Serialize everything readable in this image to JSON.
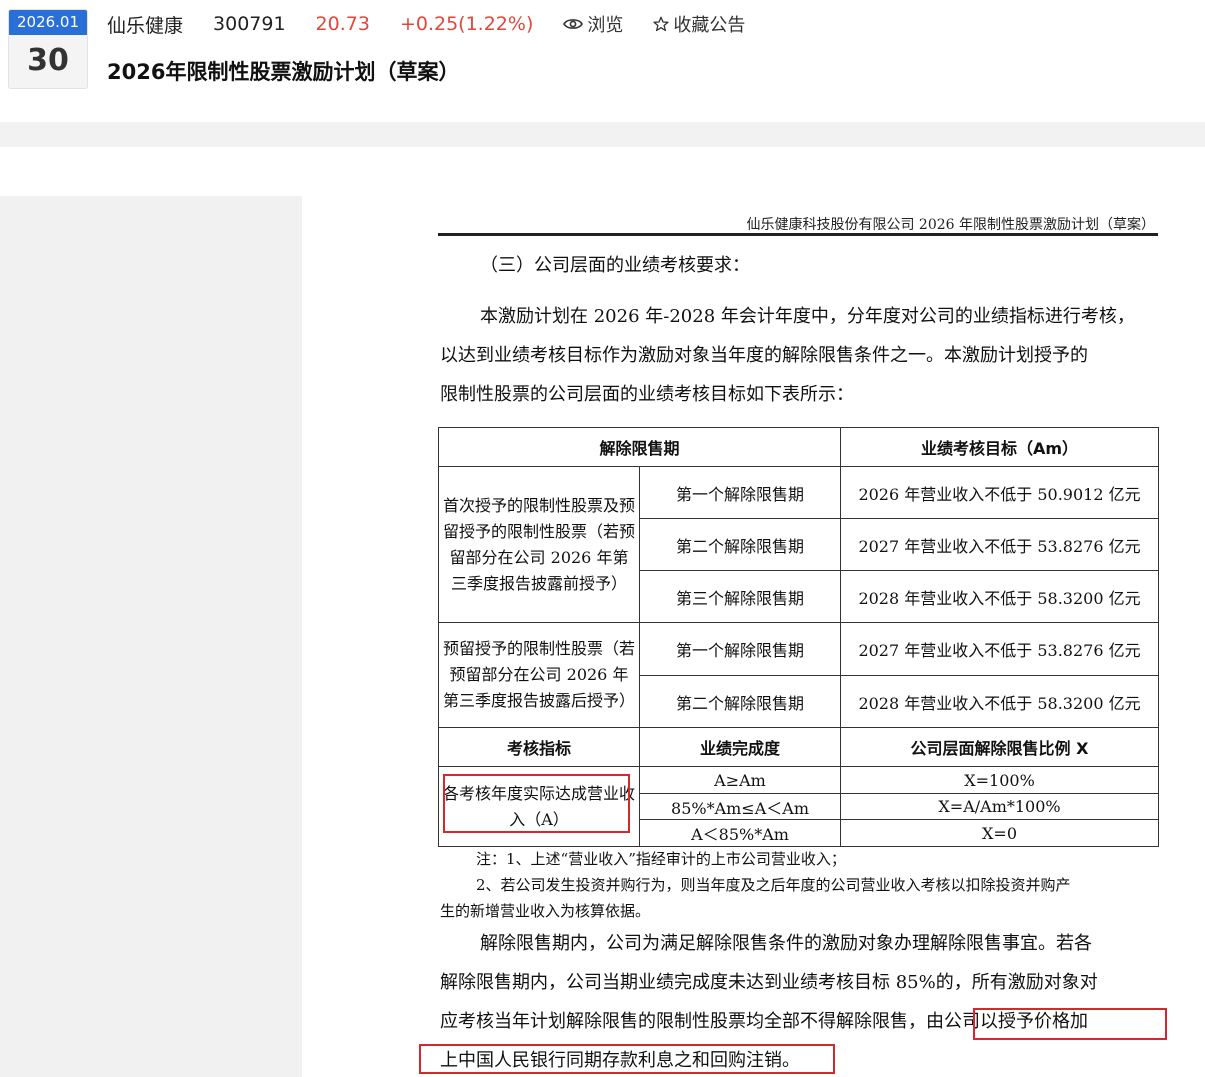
{
  "header": {
    "date_month": "2026.01",
    "date_day": "30",
    "stock_name": "仙乐健康",
    "stock_code": "300791",
    "price": "20.73",
    "change": "+0.25(1.22%)",
    "browse_label": "浏览",
    "favorite_label": "收藏公告",
    "title": "2026年限制性股票激励计划（草案）"
  },
  "colors": {
    "accent_blue": "#2a6fd8",
    "price_red": "#e0483e",
    "highlight_red": "#d6262e"
  },
  "doc": {
    "running_head": "仙乐健康科技股份有限公司 2026 年限制性股票激励计划（草案）",
    "section_heading": "（三）公司层面的业绩考核要求：",
    "intro_lines": [
      "本激励计划在 2026 年-2028 年会计年度中，分年度对公司的业绩指标进行考核，",
      "以达到业绩考核目标作为激励对象当年度的解除限售条件之一。本激励计划授予的",
      "限制性股票的公司层面的业绩考核目标如下表所示："
    ],
    "table": {
      "header_period": "解除限售期",
      "header_target": "业绩考核目标（Am）",
      "group1_label": "首次授予的限制性股票及预留授予的限制性股票（若预留部分在公司 2026 年第三季度报告披露前授予）",
      "group1_rows": [
        {
          "period": "第一个解除限售期",
          "target": "2026 年营业收入不低于 50.9012 亿元"
        },
        {
          "period": "第二个解除限售期",
          "target": "2027 年营业收入不低于 53.8276 亿元"
        },
        {
          "period": "第三个解除限售期",
          "target": "2028 年营业收入不低于 58.3200 亿元"
        }
      ],
      "group2_label": "预留授予的限制性股票（若预留部分在公司 2026 年第三季度报告披露后授予）",
      "group2_rows": [
        {
          "period": "第一个解除限售期",
          "target": "2027 年营业收入不低于 53.8276 亿元"
        },
        {
          "period": "第二个解除限售期",
          "target": "2028 年营业收入不低于 58.3200 亿元"
        }
      ],
      "header_indicator": "考核指标",
      "header_completion": "业绩完成度",
      "header_ratio": "公司层面解除限售比例 X",
      "indicator_label": "各考核年度实际达成营业收入（A）",
      "ratio_rows": [
        {
          "completion": "A≥Am",
          "ratio": "X=100%"
        },
        {
          "completion": "85%*Am≤A＜Am",
          "ratio": "X=A/Am*100%"
        },
        {
          "completion": "A＜85%*Am",
          "ratio": "X=0"
        }
      ]
    },
    "notes": [
      "注：1、上述“营业收入”指经审计的上市公司营业收入；",
      "2、若公司发生投资并购行为，则当年度及之后年度的公司营业收入考核以扣除投资并购产",
      "生的新增营业收入为核算依据。"
    ],
    "para2_lines": [
      "解除限售期内，公司为满足解除限售条件的激励对象办理解除限售事宜。若各",
      "解除限售期内，公司当期业绩完成度未达到业绩考核目标 85%的，所有激励对象对"
    ],
    "para2_line3_plain": "应考核当年计划解除限售的限制性股票均全部不得解除限售，",
    "para2_line3_hl": "由公司以授予价格加",
    "para2_line4_hl": "上中国人民银行同期存款利息之和回购注销。"
  }
}
